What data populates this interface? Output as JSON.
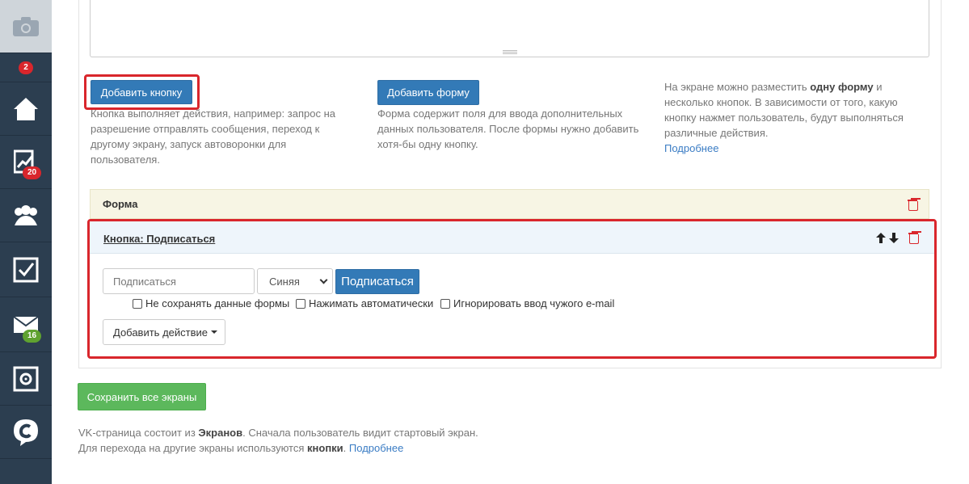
{
  "sidebar": {
    "items": [
      {
        "icon": "camera-icon"
      },
      {
        "badge": "2"
      },
      {
        "icon": "home-icon"
      },
      {
        "icon": "chart-icon",
        "badge": "20"
      },
      {
        "icon": "users-icon"
      },
      {
        "icon": "checkbox-icon"
      },
      {
        "icon": "mail-icon",
        "badge": "16"
      },
      {
        "icon": "safe-icon"
      },
      {
        "icon": "chat-logo-icon"
      }
    ]
  },
  "actions": {
    "add_button": "Добавить кнопку",
    "add_button_hint": "Кнопка выполняет действия, например: запрос на разрешение отправлять сообщения, переход к другому экрану, запуск автоворонки для пользователя.",
    "add_form": "Добавить форму",
    "add_form_hint": "Форма содержит поля для ввода дополнительных данных пользователя. После формы нужно добавить хотя-бы одну кнопку.",
    "info_pre": "На экране можно разместить ",
    "info_bold": "одну форму",
    "info_post": " и несколько кнопок. В зависимости от того, какую кнопку нажмет пользователь, будут выполняться различные действия.",
    "info_link": "Подробнее"
  },
  "form_block": {
    "title": "Форма"
  },
  "button_block": {
    "title": "Кнопка: Подписаться",
    "label_value": "Подписаться",
    "color_selected": "Синяя",
    "preview_label": "Подписаться",
    "checkboxes": [
      {
        "label": "Не сохранять данные формы",
        "checked": false
      },
      {
        "label": "Нажимать автоматически",
        "checked": false
      },
      {
        "label": "Игнорировать ввод чужого e-mail",
        "checked": false
      }
    ],
    "add_action": "Добавить действие"
  },
  "footer": {
    "save_all": "Сохранить все экраны",
    "line1_pre": "VK-страница состоит из ",
    "line1_bold": "Экранов",
    "line1_post": ". Сначала пользователь видит стартовый экран.",
    "line2_pre": "Для перехода на другие экраны используются ",
    "line2_bold": "кнопки",
    "line2_post": ". ",
    "line2_link": "Подробнее"
  },
  "colors": {
    "accent": "#337ab7",
    "danger": "#d9262c",
    "success": "#5cb85c",
    "sidebar": "#2c3e50"
  }
}
